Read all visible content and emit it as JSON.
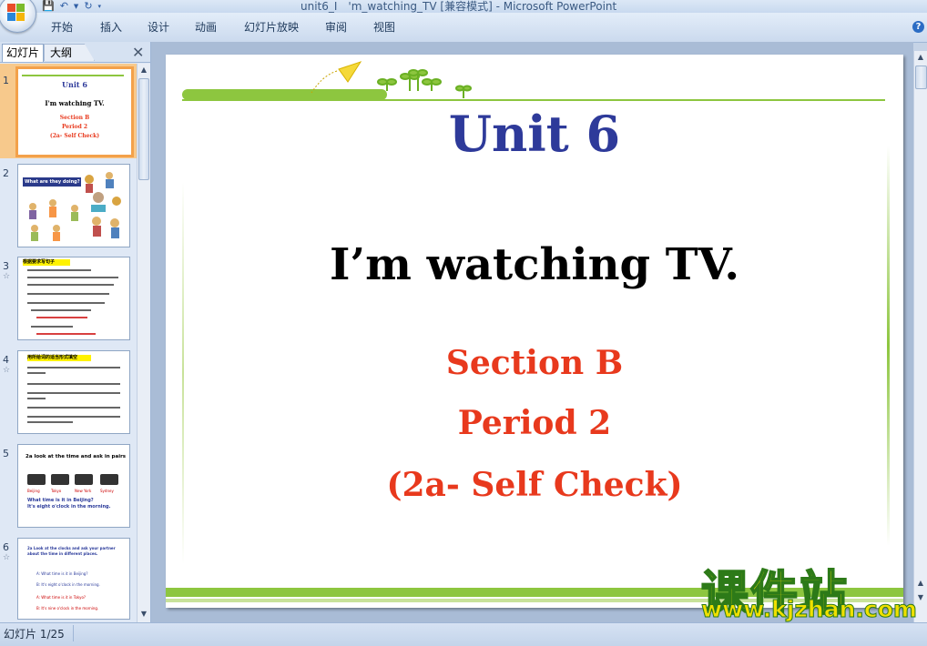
{
  "window": {
    "title": "unit6_I　'm_watching_TV [兼容模式] - Microsoft PowerPoint"
  },
  "quick_access": {
    "icons": [
      "save-icon",
      "undo-icon",
      "redo-icon"
    ]
  },
  "ribbon": {
    "tabs": [
      "开始",
      "插入",
      "设计",
      "动画",
      "幻灯片放映",
      "审阅",
      "视图"
    ],
    "help_icon": "question-icon"
  },
  "left_pane": {
    "tab_slides": "幻灯片",
    "tab_outline": "大纲",
    "close_glyph": "✕",
    "thumbnails": [
      {
        "num": "1",
        "selected": true,
        "lines": [
          "Unit 6",
          "I'm watching TV.",
          "Section B",
          "Period 2",
          "(2a- Self Check)"
        ]
      },
      {
        "num": "2",
        "header": "What are they doing?"
      },
      {
        "num": "3",
        "header": "根据要求写句子"
      },
      {
        "num": "4",
        "header": "用所给词的适当形式填空"
      },
      {
        "num": "5",
        "header": "2a  look at the time and ask in pairs",
        "cities": [
          "Beijing",
          "Tokyo",
          "New York",
          "Sydney"
        ],
        "q": "What time is it in Beijing?",
        "a": "It's eight o'clock in the morning."
      },
      {
        "num": "6",
        "header": "2a  Look at the clocks and ask your partner about the time in different places.",
        "lines": [
          "A: What time is it in Beijing?",
          "B: It's eight o'clock in the morning.",
          "A: What time is it in Tokyo?",
          "B: It's nine o'clock in the morning."
        ]
      }
    ]
  },
  "slide": {
    "unit": "Unit 6",
    "title": "I’m watching TV.",
    "section": "Section B",
    "period": "Period 2",
    "check": "(2a- Self Check)"
  },
  "watermark": {
    "cn": "课件站",
    "url": "www.kjzhan.com"
  },
  "status": {
    "text": "幻灯片 1/25"
  },
  "colors": {
    "unit_blue": "#2e3a9a",
    "red": "#e8391d",
    "green_line": "#8dc63f",
    "selection": "#f3a14a"
  }
}
